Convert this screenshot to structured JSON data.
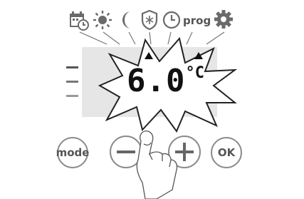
{
  "icons": [
    {
      "name": "calendar-clock",
      "label": ""
    },
    {
      "name": "sun",
      "label": ""
    },
    {
      "name": "moon",
      "label": ""
    },
    {
      "name": "frost-shield",
      "label": ""
    },
    {
      "name": "clock",
      "label": ""
    },
    {
      "name": "prog",
      "label": "prog"
    },
    {
      "name": "gear",
      "label": ""
    }
  ],
  "display": {
    "temperature": "6.0",
    "unit": "°C",
    "level_bars": 3,
    "flashing": true,
    "indicators": [
      "up-arrow",
      "up-arrow"
    ]
  },
  "buttons": [
    {
      "id": "mode",
      "label": "mode"
    },
    {
      "id": "minus",
      "label": ""
    },
    {
      "id": "plus",
      "label": ""
    },
    {
      "id": "ok",
      "label": "OK"
    }
  ],
  "colors": {
    "lcd": "#e6e6e6",
    "icon": "#666666",
    "button_border": "#8a8a8a",
    "digits": "#111111"
  }
}
